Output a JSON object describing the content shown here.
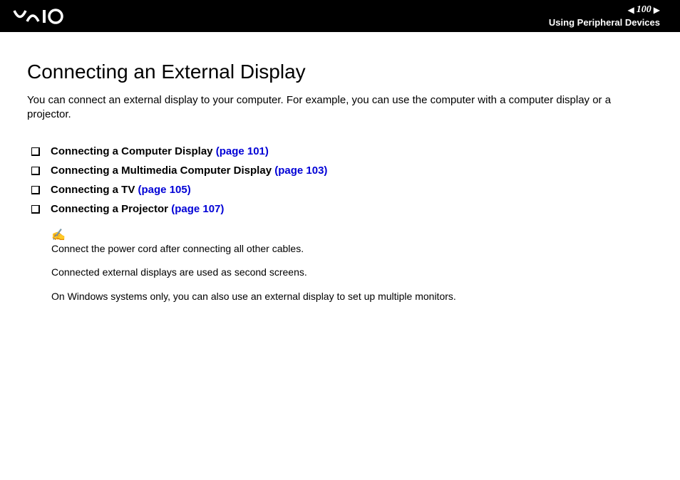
{
  "header": {
    "page_number": "100",
    "section": "Using Peripheral Devices"
  },
  "main": {
    "title": "Connecting an External Display",
    "intro": "You can connect an external display to your computer. For example, you can use the computer with a computer display or a projector.",
    "toc": [
      {
        "label": "Connecting a Computer Display",
        "page_ref": "(page 101)"
      },
      {
        "label": "Connecting a Multimedia Computer Display",
        "page_ref": "(page 103)"
      },
      {
        "label": "Connecting a TV",
        "page_ref": "(page 105)"
      },
      {
        "label": "Connecting a Projector",
        "page_ref": "(page 107)"
      }
    ],
    "notes": [
      "Connect the power cord after connecting all other cables.",
      "Connected external displays are used as second screens.",
      "On Windows systems only, you can also use an external display to set up multiple monitors."
    ]
  }
}
